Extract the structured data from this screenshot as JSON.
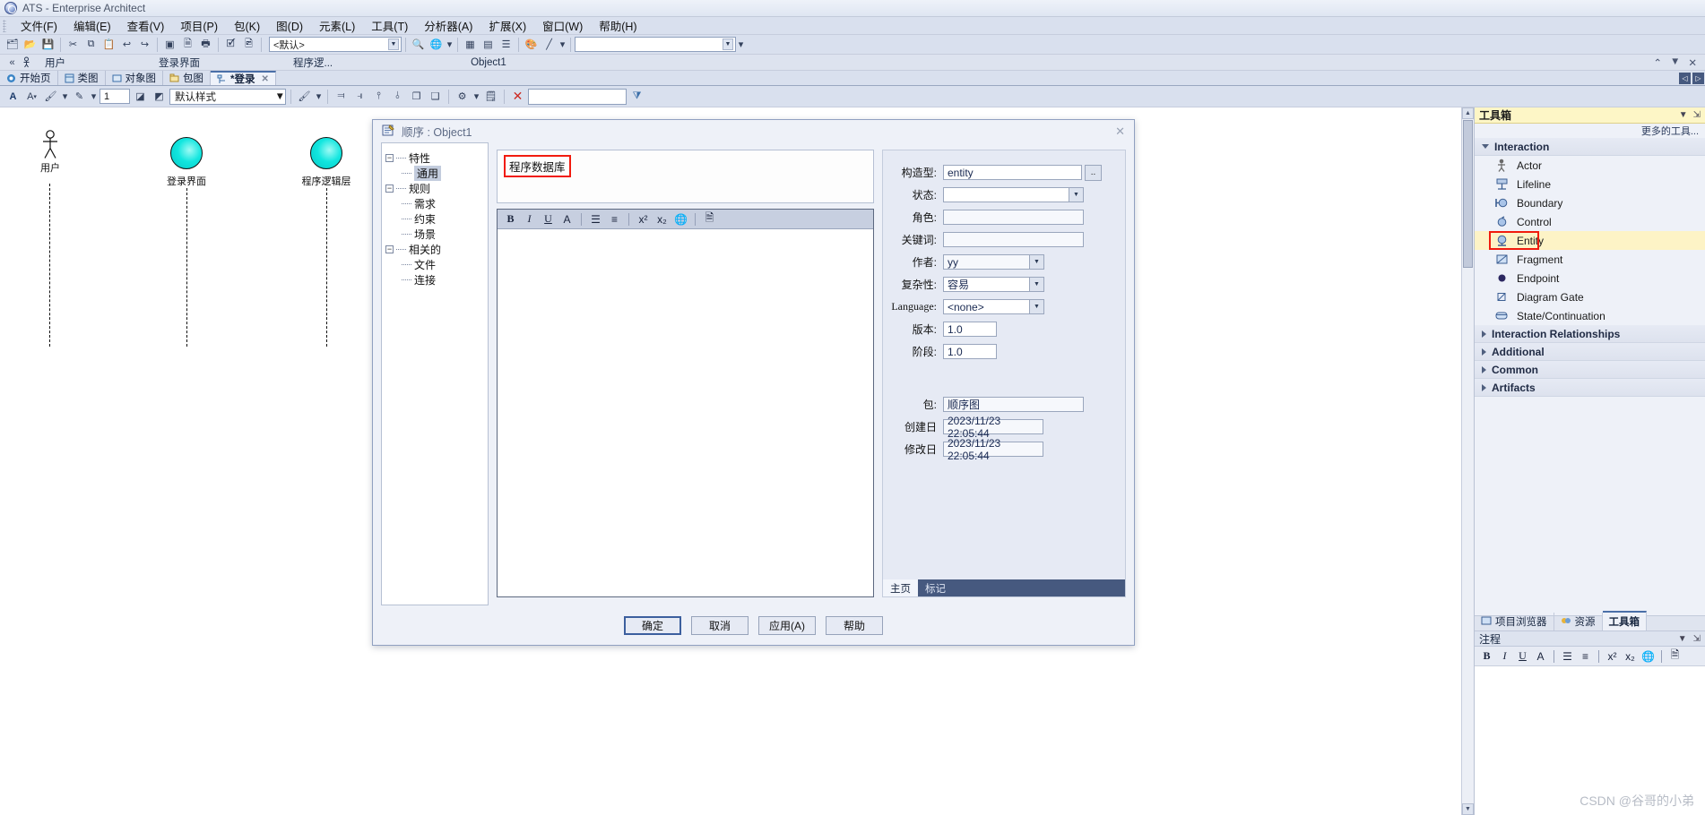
{
  "window": {
    "title": "ATS - Enterprise Architect",
    "logo_icon": "app-logo-icon"
  },
  "menubar": {
    "items": [
      {
        "label": "文件(F)"
      },
      {
        "label": "编辑(E)"
      },
      {
        "label": "查看(V)"
      },
      {
        "label": "项目(P)"
      },
      {
        "label": "包(K)"
      },
      {
        "label": "图(D)"
      },
      {
        "label": "元素(L)"
      },
      {
        "label": "工具(T)"
      },
      {
        "label": "分析器(A)"
      },
      {
        "label": "扩展(X)"
      },
      {
        "label": "窗口(W)"
      },
      {
        "label": "帮助(H)"
      }
    ]
  },
  "toolbar": {
    "default_combo": "<默认>",
    "perspective_combo": "",
    "zoom_value": "1"
  },
  "breadcrumbs": {
    "items": [
      {
        "label": "用户"
      },
      {
        "label": "登录界面"
      },
      {
        "label": "程序逻..."
      },
      {
        "label": "Object1"
      }
    ],
    "right_icons": [
      "collapse-icon",
      "dropdown-icon",
      "close-icon"
    ]
  },
  "doc_tabs": {
    "items": [
      {
        "label": "开始页",
        "icon": "home-icon",
        "active": false
      },
      {
        "label": "类图",
        "icon": "class-diagram-icon",
        "active": false
      },
      {
        "label": "对象图",
        "icon": "object-diagram-icon",
        "active": false
      },
      {
        "label": "包图",
        "icon": "package-diagram-icon",
        "active": false
      },
      {
        "label": "*登录",
        "icon": "sequence-diagram-icon",
        "active": true
      }
    ]
  },
  "format_toolbar": {
    "style_combo": "默认样式",
    "line_width": "1",
    "search_value": ""
  },
  "canvas": {
    "elements": [
      {
        "name": "用户",
        "type": "actor"
      },
      {
        "name": "登录界面",
        "type": "boundary"
      },
      {
        "name": "程序逻辑层",
        "type": "boundary"
      }
    ]
  },
  "dialog": {
    "title": "顺序 : Object1",
    "icon": "properties-icon",
    "close_icon": "close-icon",
    "tree": [
      {
        "label": "特性",
        "expanded": true,
        "level": 0,
        "selected": false
      },
      {
        "label": "通用",
        "level": 1,
        "selected": true
      },
      {
        "label": "规则",
        "expanded": true,
        "level": 0,
        "selected": false
      },
      {
        "label": "需求",
        "level": 1,
        "selected": false
      },
      {
        "label": "约束",
        "level": 1,
        "selected": false
      },
      {
        "label": "场景",
        "level": 1,
        "selected": false
      },
      {
        "label": "相关的",
        "expanded": true,
        "level": 0,
        "selected": false
      },
      {
        "label": "文件",
        "level": 1,
        "selected": false
      },
      {
        "label": "连接",
        "level": 1,
        "selected": false
      }
    ],
    "name_value": "程序数据库",
    "name_highlight_color": "#f11b0e",
    "notes_toolbar": [
      "bold-icon",
      "italic-icon",
      "underline-icon",
      "font-color-icon",
      "bullet-list-icon",
      "numbered-list-icon",
      "superscript-icon",
      "subscript-icon",
      "hyperlink-icon",
      "insert-icon"
    ],
    "notes_value": "",
    "properties": [
      {
        "label": "构造型:",
        "value": "entity",
        "kind": "text-browse"
      },
      {
        "label": "状态:",
        "value": "",
        "kind": "combo"
      },
      {
        "label": "角色:",
        "value": "",
        "kind": "text"
      },
      {
        "label": "关键词:",
        "value": "",
        "kind": "text"
      },
      {
        "label": "作者:",
        "value": "yy",
        "kind": "combo"
      },
      {
        "label": "复杂性:",
        "value": "容易",
        "kind": "combo"
      },
      {
        "label": "Language:",
        "value": "<none>",
        "kind": "combo",
        "latin": true
      },
      {
        "label": "版本:",
        "value": "1.0",
        "kind": "short"
      },
      {
        "label": "阶段:",
        "value": "1.0",
        "kind": "short"
      }
    ],
    "properties2": [
      {
        "label": "包:",
        "value": "顺序图",
        "kind": "date"
      },
      {
        "label": "创建日",
        "value": "2023/11/23 22:05:44",
        "kind": "date"
      },
      {
        "label": "修改日",
        "value": "2023/11/23 22:05:44",
        "kind": "date"
      }
    ],
    "right_tabs": [
      {
        "label": "主页",
        "active": true
      },
      {
        "label": "标记",
        "active": false
      }
    ],
    "buttons": [
      {
        "label": "确定",
        "default": true
      },
      {
        "label": "取消",
        "default": false
      },
      {
        "label": "应用(A)",
        "default": false
      },
      {
        "label": "帮助",
        "default": false
      }
    ]
  },
  "toolbox": {
    "title": "工具箱",
    "more_tools": "更多的工具...",
    "groups": [
      {
        "label": "Interaction",
        "expanded": true,
        "items": [
          {
            "label": "Actor",
            "icon": "actor-icon",
            "selected": false
          },
          {
            "label": "Lifeline",
            "icon": "lifeline-icon",
            "selected": false
          },
          {
            "label": "Boundary",
            "icon": "boundary-icon",
            "selected": false
          },
          {
            "label": "Control",
            "icon": "control-icon",
            "selected": false
          },
          {
            "label": "Entity",
            "icon": "entity-icon",
            "selected": true
          },
          {
            "label": "Fragment",
            "icon": "fragment-icon",
            "selected": false
          },
          {
            "label": "Endpoint",
            "icon": "endpoint-icon",
            "selected": false
          },
          {
            "label": "Diagram Gate",
            "icon": "diagram-gate-icon",
            "selected": false
          },
          {
            "label": "State/Continuation",
            "icon": "state-continuation-icon",
            "selected": false
          }
        ]
      },
      {
        "label": "Interaction Relationships",
        "expanded": false,
        "items": []
      },
      {
        "label": "Additional",
        "expanded": false,
        "items": []
      },
      {
        "label": "Common",
        "expanded": false,
        "items": []
      },
      {
        "label": "Artifacts",
        "expanded": false,
        "items": []
      }
    ],
    "bottom_tabs": [
      {
        "label": "项目浏览器",
        "icon": "project-browser-icon",
        "active": false
      },
      {
        "label": "资源",
        "icon": "resources-icon",
        "active": false
      },
      {
        "label": "工具箱",
        "icon": "toolbox-icon",
        "active": true
      }
    ],
    "highlight_color": "#f11b0e",
    "selected_bg": "#fdf3c6"
  },
  "notes_panel": {
    "title": "注程",
    "toolbar": [
      "bold-icon",
      "italic-icon",
      "underline-icon",
      "font-color-icon",
      "bullet-list-icon",
      "numbered-list-icon",
      "superscript-icon",
      "subscript-icon",
      "hyperlink-icon",
      "insert-icon"
    ]
  },
  "watermark": "CSDN @谷哥的小弟"
}
